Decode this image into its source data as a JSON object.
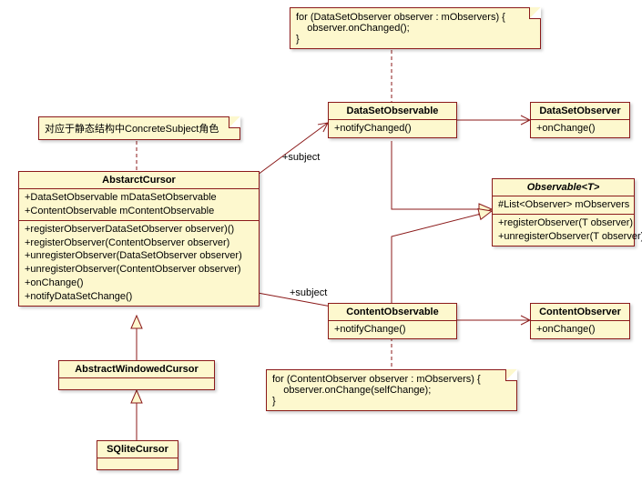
{
  "notes": {
    "top": {
      "line1": "for (DataSetObserver observer : mObservers) {",
      "line2": "    observer.onChanged();",
      "line3": "}"
    },
    "concrete_subject": "对应于静态结构中ConcreteSubject角色",
    "bottom": {
      "line1": "for (ContentObserver observer : mObservers) {",
      "line2": "    observer.onChange(selfChange);",
      "line3": "}"
    }
  },
  "classes": {
    "abstract_cursor": {
      "name": "AbstarctCursor",
      "attrs": [
        "+DataSetObservable  mDataSetObservable",
        "+ContentObservable mContentObservable"
      ],
      "ops": [
        "+registerObserverDataSetObserver observer)()",
        "+registerObserver(ContentObserver observer)",
        "+unregisterObserver(DataSetObserver observer)",
        "+unregisterObserver(ContentObserver observer)",
        "+onChange()",
        "+notifyDataSetChange()"
      ]
    },
    "abstract_windowed_cursor": {
      "name": "AbstractWindowedCursor"
    },
    "sqlite_cursor": {
      "name": "SQliteCursor"
    },
    "dataset_observable": {
      "name": "DataSetObservable",
      "ops": [
        "+notifyChanged()"
      ]
    },
    "dataset_observer": {
      "name": "DataSetObserver",
      "ops": [
        "+onChange()"
      ]
    },
    "observable_t": {
      "name": "Observable<T>",
      "attrs": [
        "#List<Observer> mObservers"
      ],
      "ops": [
        "+registerObserver(T observer)",
        "+unregisterObserver(T observer)"
      ]
    },
    "content_observable": {
      "name": "ContentObservable",
      "ops": [
        "+notifyChange()"
      ]
    },
    "content_observer": {
      "name": "ContentObserver",
      "ops": [
        "+onChange()"
      ]
    }
  },
  "labels": {
    "subject1": "+subject",
    "subject2": "+subject"
  }
}
